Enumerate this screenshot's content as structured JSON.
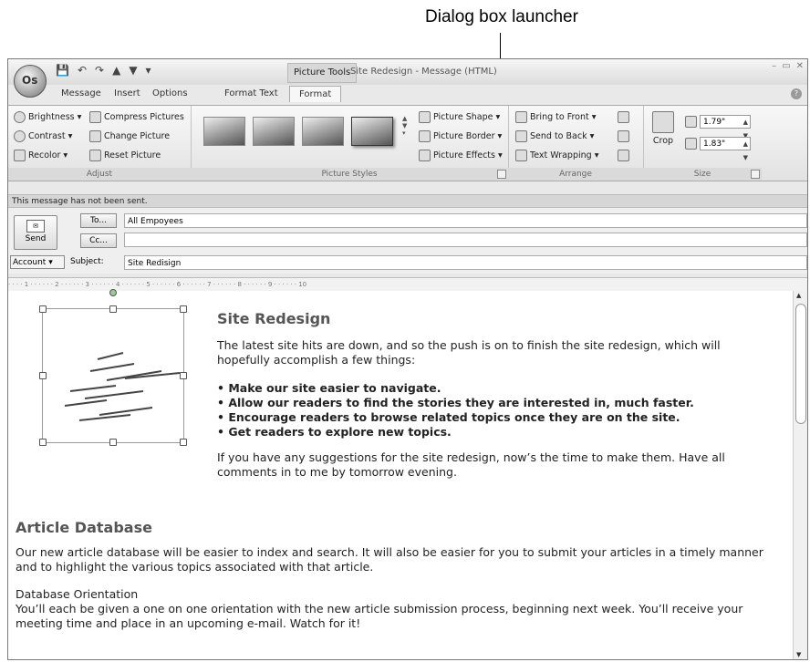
{
  "callout": "Dialog box launcher",
  "titlebar": {
    "office_button": "Os",
    "qat": [
      "💾",
      "↶",
      "↷",
      "▲",
      "▼",
      "▾"
    ],
    "context_tab": "Picture Tools",
    "title": "Site Redesign - Message (HTML)",
    "controls": [
      "–",
      "▭",
      "✕"
    ]
  },
  "tabs": [
    "Message",
    "Insert",
    "Options",
    "Format Text",
    "Format"
  ],
  "ribbon": {
    "adjust": {
      "items": [
        "Brightness ▾",
        "Contrast ▾",
        "Recolor ▾",
        "Compress Pictures",
        "Change Picture",
        "Reset Picture"
      ],
      "label": "Adjust"
    },
    "styles": {
      "label": "Picture Styles",
      "items": [
        "Picture Shape ▾",
        "Picture Border ▾",
        "Picture Effects ▾"
      ]
    },
    "arrange": {
      "items": [
        "Bring to Front ▾",
        "Send to Back ▾",
        "Text Wrapping ▾"
      ],
      "label": "Arrange"
    },
    "size": {
      "crop": "Crop",
      "height": "1.79\"",
      "width": "1.83\"",
      "label": "Size"
    }
  },
  "infobar": "This message has not been sent.",
  "header": {
    "send": "Send",
    "to_button": "To...",
    "cc_button": "Cc...",
    "to_value": "All Empoyees",
    "cc_value": "",
    "account": "Account",
    "subject_label": "Subject:",
    "subject_value": "Site Redisign"
  },
  "ruler": "·  ·  ·  ·  1  ·  ·  ·  ·  ·  ·  2  ·  ·  ·  ·  ·  ·  3  ·  ·  ·  ·  ·  ·  4  ·  ·  ·  ·  ·  ·  5  ·  ·  ·  ·  ·  ·  6  ·  ·  ·  ·  ·  ·  7  ·  ·  ·  ·  ·  ·  8  ·  ·  ·  ·  ·  ·  9  ·  ·  ·  ·  ·  ·  10",
  "body": {
    "heading1": "Site Redesign",
    "para1": "The latest site hits are down, and so the push is on to finish the site redesign, which will hopefully accomplish a few things:",
    "bullets": [
      "Make our site easier to navigate.",
      "Allow our readers to find the stories they are interested in, much faster.",
      "Encourage readers to browse related topics once they are on the site.",
      "Get readers to explore new topics."
    ],
    "para2": "If you have any suggestions for the site redesign, now’s the time to make them. Have all comments in to me by tomorrow evening.",
    "heading2": "Article Database",
    "para3": "Our new article database will be easier to index and search. It will also be easier for you to submit your articles in a timely manner and to highlight the various topics associated with that article.",
    "sub_heading": "Database Orientation",
    "para4": "You’ll each be given a one on one orientation with the new article submission process, beginning next week. You’ll receive your meeting time and place in an upcoming e-mail. Watch for it!"
  }
}
